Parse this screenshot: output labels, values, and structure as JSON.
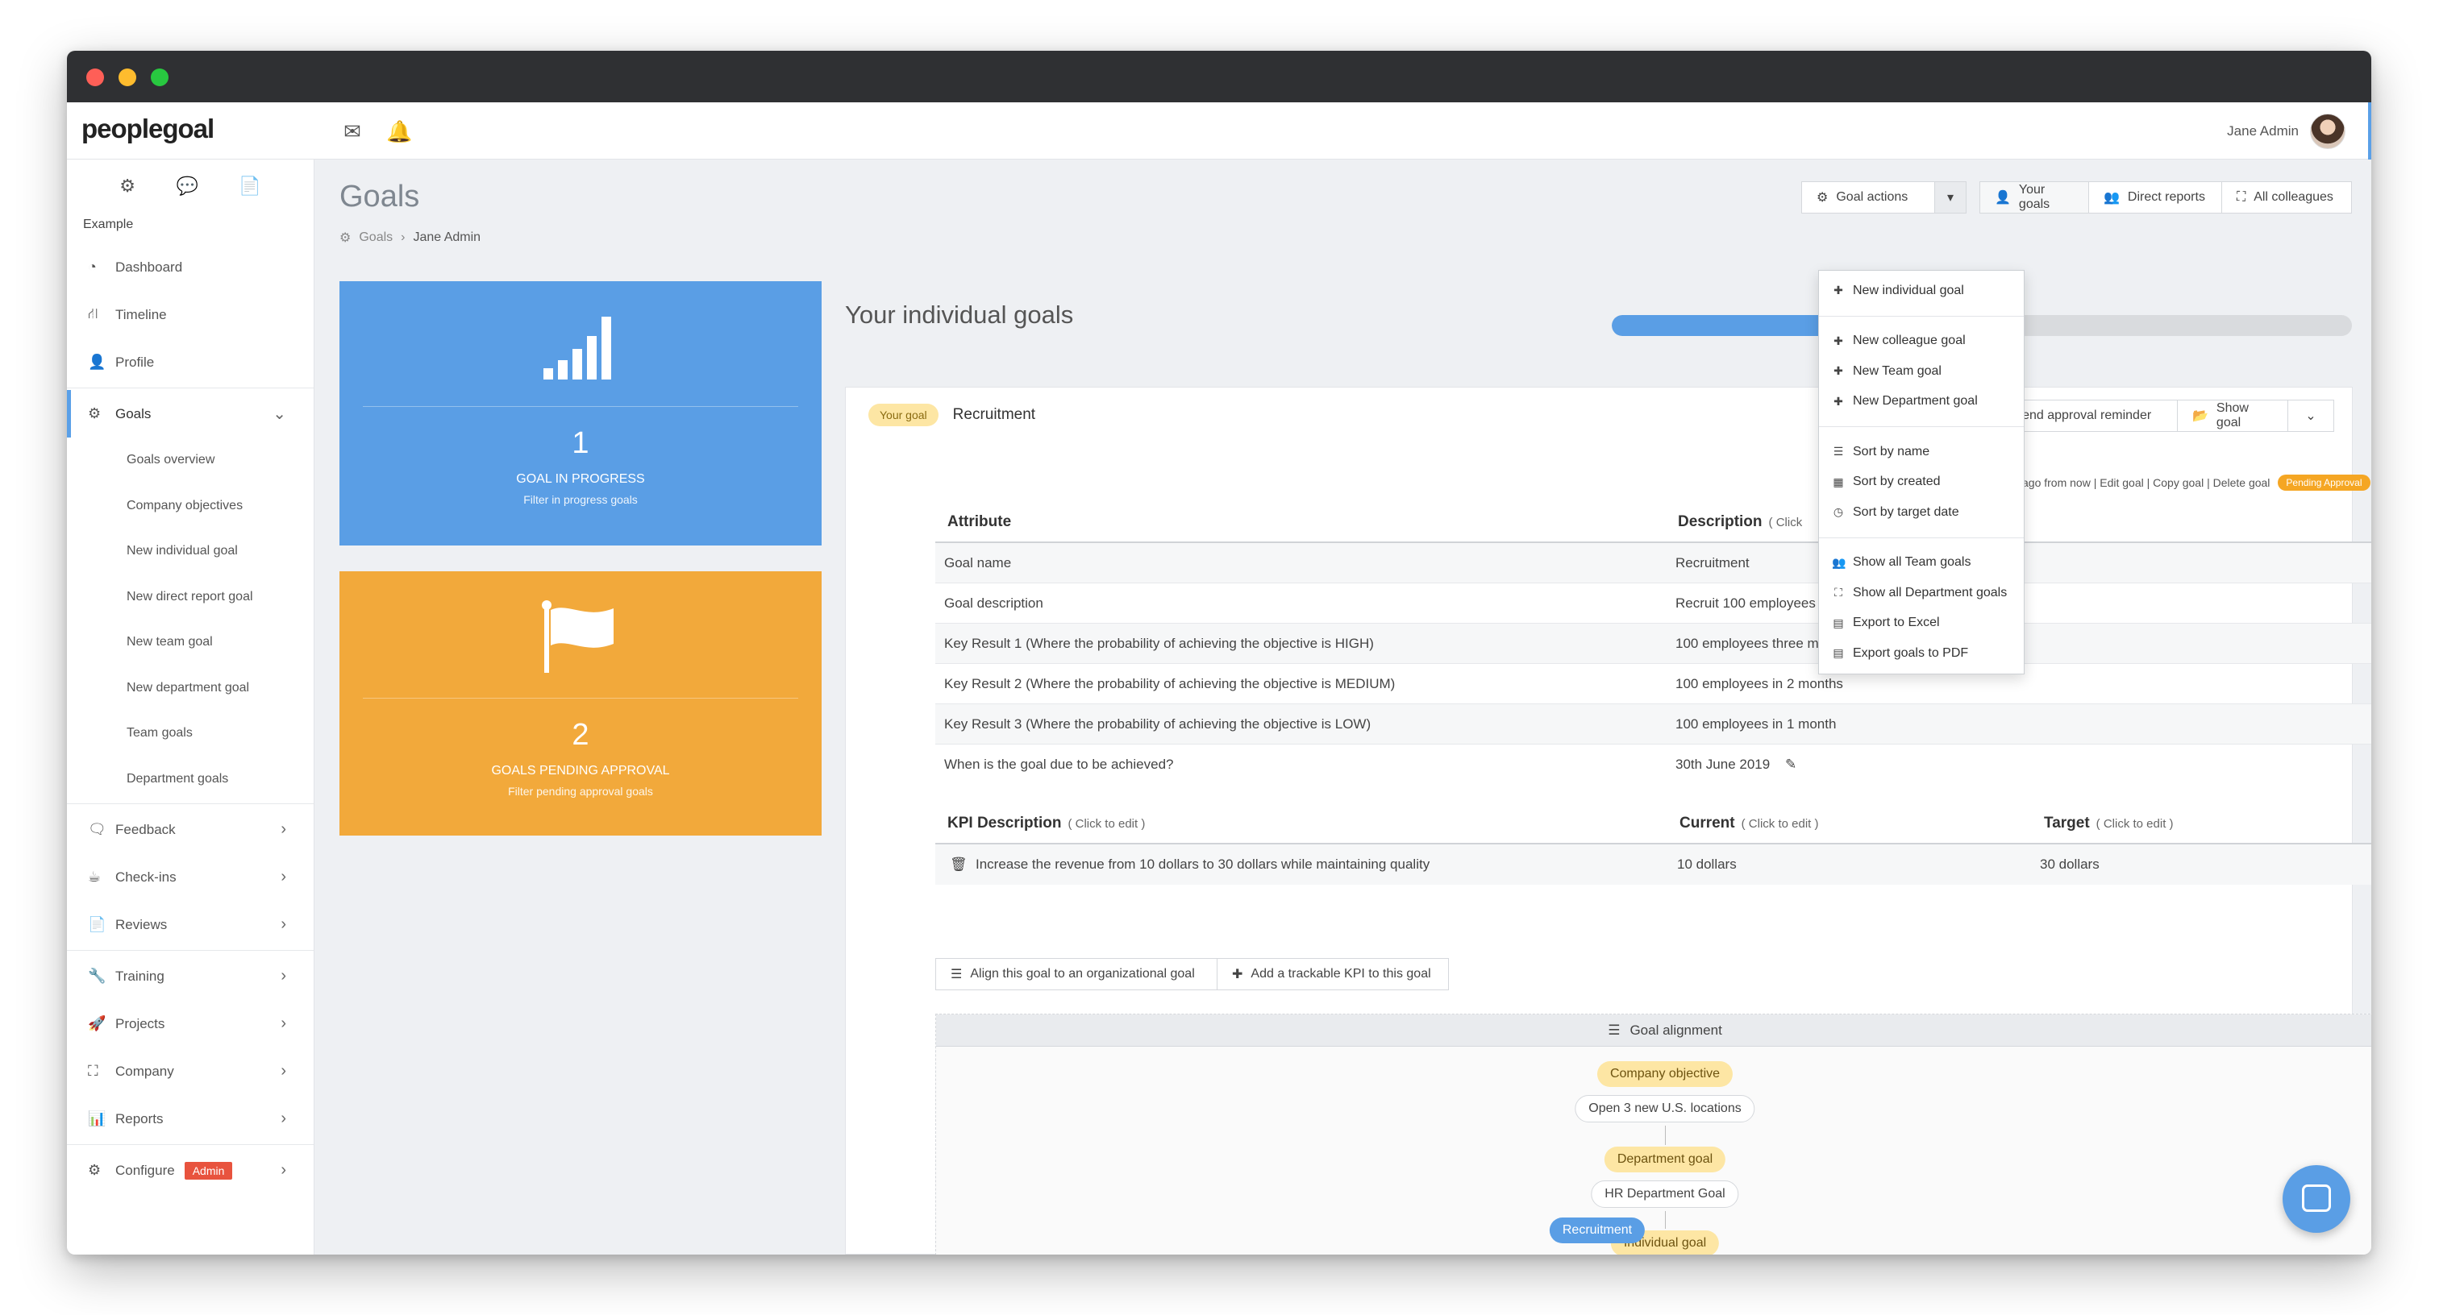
{
  "app": {
    "logo": "peoplegoal",
    "user_name": "Jane Admin",
    "org": "Example"
  },
  "nav": {
    "items": [
      {
        "label": "Dashboard"
      },
      {
        "label": "Timeline"
      },
      {
        "label": "Profile"
      },
      {
        "label": "Goals"
      },
      {
        "label": "Feedback"
      },
      {
        "label": "Check-ins"
      },
      {
        "label": "Reviews"
      },
      {
        "label": "Training"
      },
      {
        "label": "Projects"
      },
      {
        "label": "Company"
      },
      {
        "label": "Reports"
      },
      {
        "label": "Configure"
      }
    ],
    "goals_sub": [
      {
        "label": "Goals overview"
      },
      {
        "label": "Company objectives"
      },
      {
        "label": "New individual goal"
      },
      {
        "label": "New direct report goal"
      },
      {
        "label": "New team goal"
      },
      {
        "label": "New department goal"
      },
      {
        "label": "Team goals"
      },
      {
        "label": "Department goals"
      }
    ],
    "admin_badge": "Admin"
  },
  "page": {
    "title": "Goals",
    "breadcrumb": [
      "Goals",
      "Jane Admin"
    ]
  },
  "cards": {
    "in_progress": {
      "count": "1",
      "label": "GOAL IN PROGRESS",
      "sub": "Filter in progress goals",
      "color": "#5a9ee5"
    },
    "pending": {
      "count": "2",
      "label": "GOALS PENDING APPROVAL",
      "sub": "Filter pending approval goals",
      "color": "#f2a93b"
    }
  },
  "toolbar": {
    "goal_actions": "Goal actions",
    "your_goals": "Your goals",
    "direct_reports": "Direct reports",
    "all_colleagues": "All colleagues"
  },
  "dropdown": {
    "group1": [
      "New individual goal"
    ],
    "group2": [
      "New colleague goal",
      "New Team goal",
      "New Department goal"
    ],
    "group3": [
      "Sort by name",
      "Sort by created",
      "Sort by target date"
    ],
    "group4": [
      "Show all Team goals",
      "Show all Department goals",
      "Export to Excel",
      "Export goals to PDF"
    ]
  },
  "section": {
    "title": "Your individual goals",
    "progress": 0.5
  },
  "goal": {
    "tag": "Your goal",
    "name": "Recruitment",
    "send_reminder": "Send approval reminder",
    "show_goal": "Show goal",
    "meta_links": "ago from now | Edit goal | Copy goal | Delete goal",
    "pending_badge": "Pending Approval",
    "attr_header": "Attribute",
    "desc_header": "Description",
    "desc_hint": "( Click",
    "rows": [
      {
        "attr": "Goal name",
        "desc": "Recruitment"
      },
      {
        "attr": "Goal description",
        "desc": "Recruit 100 employees"
      },
      {
        "attr": "Key Result 1 (Where the probability of achieving the objective is HIGH)",
        "desc": "100 employees three months"
      },
      {
        "attr": "Key Result 2 (Where the probability of achieving the objective is MEDIUM)",
        "desc": "100 employees in 2 months"
      },
      {
        "attr": "Key Result 3 (Where the probability of achieving the objective is LOW)",
        "desc": "100 employees in 1 month"
      },
      {
        "attr": "When is the goal due to be achieved?",
        "desc": "30th June 2019"
      }
    ],
    "kpi": {
      "h1": "KPI Description",
      "h2": "Current",
      "h3": "Target",
      "hint": "( Click to edit )",
      "row": {
        "desc": "Increase the revenue from 10 dollars to 30 dollars while maintaining quality",
        "current": "10 dollars",
        "target": "30 dollars"
      }
    },
    "align_btn": "Align this goal to an organizational goal",
    "kpi_btn": "Add a trackable KPI to this goal"
  },
  "alignment": {
    "title": "Goal alignment",
    "nodes": [
      {
        "cat": "Company objective",
        "val": "Open 3 new U.S. locations"
      },
      {
        "cat": "Department goal",
        "val": "HR Department Goal"
      },
      {
        "cat": "Individual goal",
        "val": "Recruitment"
      }
    ]
  }
}
